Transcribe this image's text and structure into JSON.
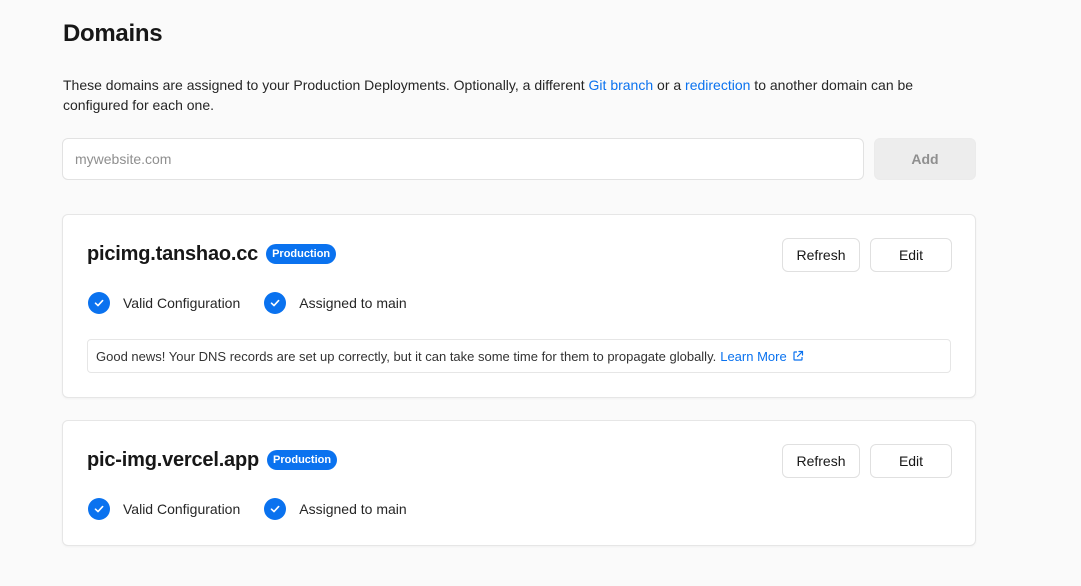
{
  "page": {
    "title": "Domains",
    "description_part1": "These domains are assigned to your Production Deployments. Optionally, a different ",
    "git_branch_link": "Git branch",
    "description_part2": " or a ",
    "redirection_link": "redirection",
    "description_part3": " to another domain can be configured for each one."
  },
  "add_domain": {
    "placeholder": "mywebsite.com",
    "value": "",
    "add_label": "Add"
  },
  "domains": [
    {
      "name": "picimg.tanshao.cc",
      "badge": "Production",
      "refresh_label": "Refresh",
      "edit_label": "Edit",
      "status_1": "Valid Configuration",
      "status_2": "Assigned to main",
      "notice": "Good news! Your DNS records are set up correctly, but it can take some time for them to propagate globally.",
      "notice_link": "Learn More"
    },
    {
      "name": "pic-img.vercel.app",
      "badge": "Production",
      "refresh_label": "Refresh",
      "edit_label": "Edit",
      "status_1": "Valid Configuration",
      "status_2": "Assigned to main"
    }
  ],
  "icons": {
    "check": "check-circle-icon",
    "external_link": "external-link-icon"
  },
  "colors": {
    "accent": "#0a72ef",
    "background": "#fafafa",
    "card": "#ffffff"
  }
}
